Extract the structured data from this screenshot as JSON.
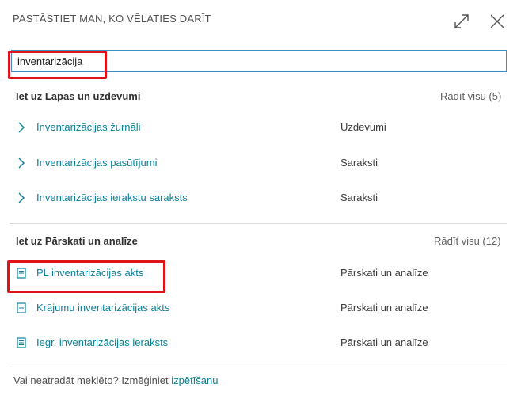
{
  "header": {
    "title": "PASTĀSTIET MAN, KO VĒLATIES DARĪT",
    "expand_icon": "expand-icon",
    "close_icon": "close-icon"
  },
  "search": {
    "value": "inventarizācija",
    "placeholder": ""
  },
  "sections": [
    {
      "heading": "Iet uz Lapas un uzdevumi",
      "show_all": "Rādīt visu (5)",
      "items": [
        {
          "icon": "chevron-right-icon",
          "label": "Inventarizācijas žurnāli",
          "category": "Uzdevumi"
        },
        {
          "icon": "chevron-right-icon",
          "label": "Inventarizācijas pasūtījumi",
          "category": "Saraksti"
        },
        {
          "icon": "chevron-right-icon",
          "label": "Inventarizācijas ierakstu saraksts",
          "category": "Saraksti"
        }
      ]
    },
    {
      "heading": "Iet uz Pārskati un analīze",
      "show_all": "Rādīt visu (12)",
      "items": [
        {
          "icon": "report-icon",
          "label": "PL inventarizācijas akts",
          "category": "Pārskati un analīze"
        },
        {
          "icon": "report-icon",
          "label": "Krājumu inventarizācijas akts",
          "category": "Pārskati un analīze"
        },
        {
          "icon": "report-icon",
          "label": "Iegr. inventarizācijas ieraksts",
          "category": "Pārskati un analīze"
        }
      ]
    }
  ],
  "footer": {
    "text": "Vai neatradāt meklēto? Izmēģiniet ",
    "link": "izpētīšanu"
  },
  "colors": {
    "accent": "#0a7f9a",
    "highlight": "#e0121a",
    "focus_border": "#3a8fc4"
  }
}
